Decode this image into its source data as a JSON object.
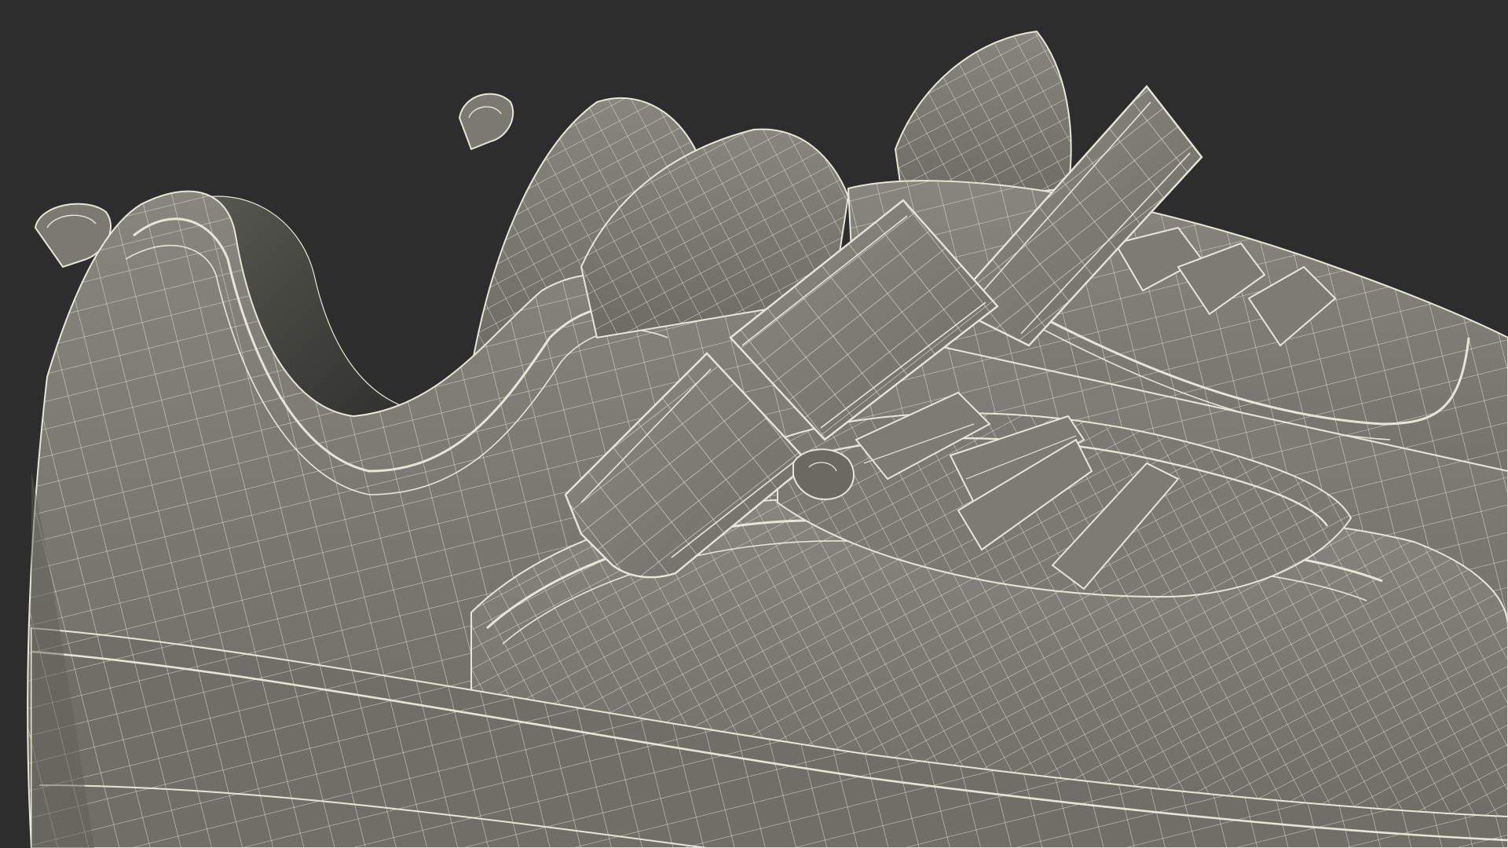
{
  "scene": {
    "subject": "sneaker-wireframe-render",
    "render_mode": "wireframe-over-clay",
    "colors": {
      "background": "#2d2d2d",
      "surface": "#7a7a72",
      "surface_dark": "#5f5f58",
      "surface_shadow": "#3c3c38",
      "wire": "#e6e6d8"
    },
    "parts": [
      "heel-pull-tab-left",
      "heel-pull-tab-right",
      "heel-collar",
      "tongue",
      "strap-upper",
      "strap-lower",
      "laces",
      "toe-box",
      "sole-band"
    ]
  }
}
